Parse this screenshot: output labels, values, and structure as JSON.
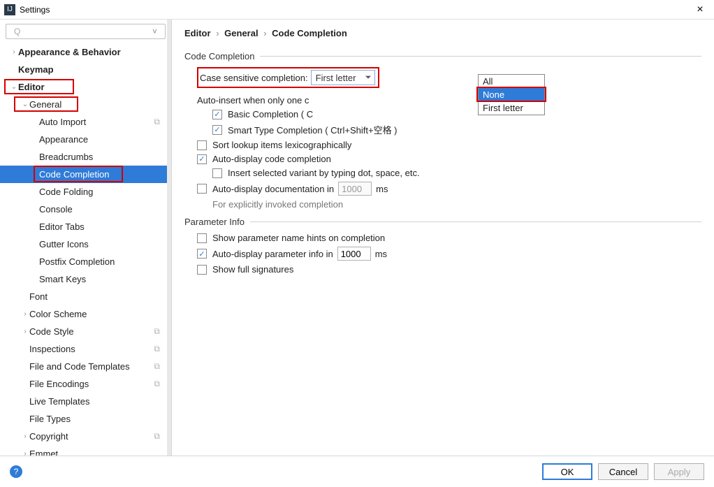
{
  "window": {
    "title": "Settings"
  },
  "search": {
    "placeholder": ""
  },
  "tree": [
    {
      "label": "Appearance & Behavior",
      "indent": 0,
      "arrow": "›",
      "bold": true
    },
    {
      "label": "Keymap",
      "indent": 0,
      "arrow": "",
      "bold": true
    },
    {
      "label": "Editor",
      "indent": 0,
      "arrow": "⌄",
      "bold": true
    },
    {
      "label": "General",
      "indent": 1,
      "arrow": "⌄",
      "bold": false
    },
    {
      "label": "Auto Import",
      "indent": 2,
      "arrow": "",
      "copy": true
    },
    {
      "label": "Appearance",
      "indent": 2,
      "arrow": ""
    },
    {
      "label": "Breadcrumbs",
      "indent": 2,
      "arrow": ""
    },
    {
      "label": "Code Completion",
      "indent": 2,
      "arrow": "",
      "selected": true
    },
    {
      "label": "Code Folding",
      "indent": 2,
      "arrow": ""
    },
    {
      "label": "Console",
      "indent": 2,
      "arrow": ""
    },
    {
      "label": "Editor Tabs",
      "indent": 2,
      "arrow": ""
    },
    {
      "label": "Gutter Icons",
      "indent": 2,
      "arrow": ""
    },
    {
      "label": "Postfix Completion",
      "indent": 2,
      "arrow": ""
    },
    {
      "label": "Smart Keys",
      "indent": 2,
      "arrow": ""
    },
    {
      "label": "Font",
      "indent": 1,
      "arrow": ""
    },
    {
      "label": "Color Scheme",
      "indent": 1,
      "arrow": "›"
    },
    {
      "label": "Code Style",
      "indent": 1,
      "arrow": "›",
      "copy": true
    },
    {
      "label": "Inspections",
      "indent": 1,
      "arrow": "",
      "copy": true
    },
    {
      "label": "File and Code Templates",
      "indent": 1,
      "arrow": "",
      "copy": true
    },
    {
      "label": "File Encodings",
      "indent": 1,
      "arrow": "",
      "copy": true
    },
    {
      "label": "Live Templates",
      "indent": 1,
      "arrow": ""
    },
    {
      "label": "File Types",
      "indent": 1,
      "arrow": ""
    },
    {
      "label": "Copyright",
      "indent": 1,
      "arrow": "›",
      "copy": true
    },
    {
      "label": "Emmet",
      "indent": 1,
      "arrow": "›"
    }
  ],
  "breadcrumb": {
    "a": "Editor",
    "b": "General",
    "c": "Code Completion"
  },
  "sections": {
    "s1": "Code Completion",
    "caseLabel": "Case sensitive completion:",
    "caseValue": "First letter",
    "ddOptions": [
      "All",
      "None",
      "First letter"
    ],
    "autoInsertLabel": "Auto-insert when only one c",
    "basic": "Basic Completion ( C",
    "smart": "Smart Type Completion ( Ctrl+Shift+空格 )",
    "sortLex": "Sort lookup items lexicographically",
    "autoDisp": "Auto-display code completion",
    "insertDot": "Insert selected variant by typing dot, space, etc.",
    "autoDocPre": "Auto-display documentation in",
    "autoDocVal": "1000",
    "autoDocSuf": "ms",
    "autoDocHint": "For explicitly invoked completion",
    "s2": "Parameter Info",
    "paramHint": "Show parameter name hints on completion",
    "autoParamPre": "Auto-display parameter info in",
    "autoParamVal": "1000",
    "autoParamSuf": "ms",
    "fullSig": "Show full signatures"
  },
  "buttons": {
    "ok": "OK",
    "cancel": "Cancel",
    "apply": "Apply"
  }
}
